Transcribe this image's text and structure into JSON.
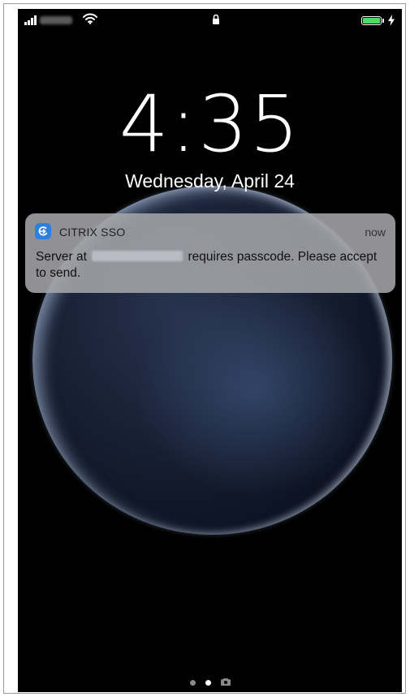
{
  "status_bar": {
    "signal_icon": "cellular-signal-icon",
    "wifi_icon": "wifi-icon",
    "lock_icon": "lock-icon",
    "battery_icon": "battery-icon",
    "charging_icon": "charging-bolt-icon",
    "battery_color": "#4cd964"
  },
  "lock_screen": {
    "time": "4:35",
    "date": "Wednesday, April 24"
  },
  "notification": {
    "app_icon": "citrix-sso-icon",
    "app_name": "CITRIX SSO",
    "time": "now",
    "body_prefix": "Server at",
    "body_suffix": "requires passcode. Please accept to send.",
    "accent_color": "#2f7fe0"
  },
  "page_indicator": {
    "camera_icon": "camera-icon",
    "active_index": 1
  }
}
